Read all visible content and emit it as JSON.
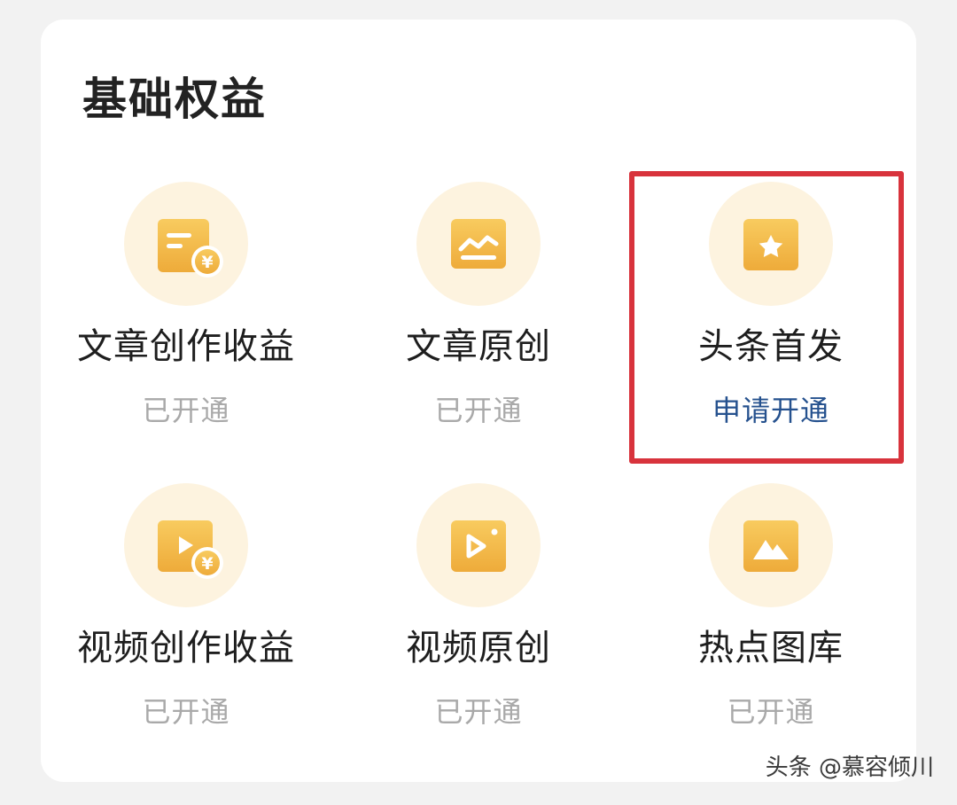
{
  "section": {
    "title": "基础权益"
  },
  "items": [
    {
      "label": "文章创作收益",
      "status": "已开通",
      "icon": "article-income-icon"
    },
    {
      "label": "文章原创",
      "status": "已开通",
      "icon": "article-original-icon"
    },
    {
      "label": "头条首发",
      "status": "申请开通",
      "icon": "star-icon"
    },
    {
      "label": "视频创作收益",
      "status": "已开通",
      "icon": "video-income-icon"
    },
    {
      "label": "视频原创",
      "status": "已开通",
      "icon": "video-original-icon"
    },
    {
      "label": "热点图库",
      "status": "已开通",
      "icon": "image-gallery-icon"
    }
  ],
  "watermark": "头条 @慕容倾川",
  "colors": {
    "icon_gold": "#f2b845",
    "icon_circle": "#fdf3df",
    "apply_link": "#25518e",
    "highlight": "#d8333c",
    "status_gray": "#a9a9a9"
  }
}
